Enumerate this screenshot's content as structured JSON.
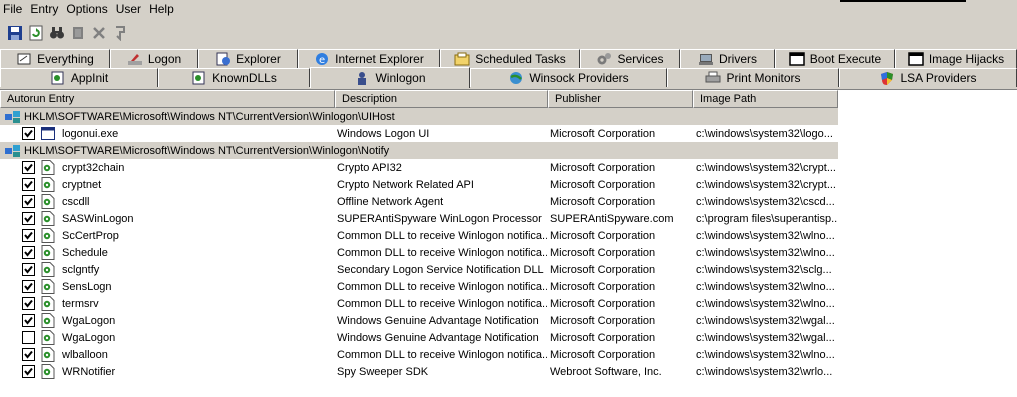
{
  "menu": [
    "File",
    "Entry",
    "Options",
    "User",
    "Help"
  ],
  "toolbar": [
    {
      "name": "save-icon"
    },
    {
      "name": "refresh-icon"
    },
    {
      "name": "find-icon"
    },
    {
      "name": "copy-icon"
    },
    {
      "name": "delete-icon"
    },
    {
      "name": "jump-icon"
    }
  ],
  "tabs_row1": [
    {
      "label": "Everything",
      "icon": "everything-icon"
    },
    {
      "label": "Logon",
      "icon": "logon-icon"
    },
    {
      "label": "Explorer",
      "icon": "explorer-icon"
    },
    {
      "label": "Internet Explorer",
      "icon": "internet-explorer-icon"
    },
    {
      "label": "Scheduled Tasks",
      "icon": "scheduled-tasks-icon"
    },
    {
      "label": "Services",
      "icon": "services-icon"
    },
    {
      "label": "Drivers",
      "icon": "drivers-icon"
    },
    {
      "label": "Boot Execute",
      "icon": "boot-execute-icon"
    },
    {
      "label": "Image Hijacks",
      "icon": "image-hijacks-icon"
    }
  ],
  "tabs_row2": [
    {
      "label": "AppInit",
      "icon": "appinit-icon"
    },
    {
      "label": "KnownDLLs",
      "icon": "knowndlls-icon"
    },
    {
      "label": "Winlogon",
      "icon": "winlogon-icon",
      "selected": true
    },
    {
      "label": "Winsock Providers",
      "icon": "winsock-icon"
    },
    {
      "label": "Print Monitors",
      "icon": "print-monitors-icon"
    },
    {
      "label": "LSA Providers",
      "icon": "lsa-providers-icon"
    }
  ],
  "columns": [
    "Autorun Entry",
    "Description",
    "Publisher",
    "Image Path"
  ],
  "groups": [
    {
      "key": "HKLM\\SOFTWARE\\Microsoft\\Windows NT\\CurrentVersion\\Winlogon\\UIHost",
      "entries": [
        {
          "name": "logonui.exe",
          "checked": true,
          "icon": "window-icon",
          "description": "Windows Logon UI",
          "publisher": "Microsoft Corporation",
          "path": "c:\\windows\\system32\\logo..."
        }
      ]
    },
    {
      "key": "HKLM\\SOFTWARE\\Microsoft\\Windows NT\\CurrentVersion\\Winlogon\\Notify",
      "entries": [
        {
          "name": "crypt32chain",
          "checked": true,
          "icon": "dll-icon",
          "description": "Crypto API32",
          "publisher": "Microsoft Corporation",
          "path": "c:\\windows\\system32\\crypt..."
        },
        {
          "name": "cryptnet",
          "checked": true,
          "icon": "dll-icon",
          "description": "Crypto Network Related API",
          "publisher": "Microsoft Corporation",
          "path": "c:\\windows\\system32\\crypt..."
        },
        {
          "name": "cscdll",
          "checked": true,
          "icon": "dll-icon",
          "description": "Offline Network Agent",
          "publisher": "Microsoft Corporation",
          "path": "c:\\windows\\system32\\cscd..."
        },
        {
          "name": "SASWinLogon",
          "checked": true,
          "icon": "dll-icon",
          "description": "SUPERAntiSpyware WinLogon Processor",
          "publisher": "SUPERAntiSpyware.com",
          "path": "c:\\program files\\superantisp..."
        },
        {
          "name": "ScCertProp",
          "checked": true,
          "icon": "dll-icon",
          "description": "Common DLL to receive Winlogon notifica...",
          "publisher": "Microsoft Corporation",
          "path": "c:\\windows\\system32\\wlno..."
        },
        {
          "name": "Schedule",
          "checked": true,
          "icon": "dll-icon",
          "description": "Common DLL to receive Winlogon notifica...",
          "publisher": "Microsoft Corporation",
          "path": "c:\\windows\\system32\\wlno..."
        },
        {
          "name": "sclgntfy",
          "checked": true,
          "icon": "dll-icon",
          "description": "Secondary Logon Service Notification DLL",
          "publisher": "Microsoft Corporation",
          "path": "c:\\windows\\system32\\sclg..."
        },
        {
          "name": "SensLogn",
          "checked": true,
          "icon": "dll-icon",
          "description": "Common DLL to receive Winlogon notifica...",
          "publisher": "Microsoft Corporation",
          "path": "c:\\windows\\system32\\wlno..."
        },
        {
          "name": "termsrv",
          "checked": true,
          "icon": "dll-icon",
          "description": "Common DLL to receive Winlogon notifica...",
          "publisher": "Microsoft Corporation",
          "path": "c:\\windows\\system32\\wlno..."
        },
        {
          "name": "WgaLogon",
          "checked": true,
          "icon": "dll-icon",
          "description": "Windows Genuine Advantage Notification",
          "publisher": "Microsoft Corporation",
          "path": "c:\\windows\\system32\\wgal..."
        },
        {
          "name": "WgaLogon",
          "checked": false,
          "icon": "dll-icon",
          "description": "Windows Genuine Advantage Notification",
          "publisher": "Microsoft Corporation",
          "path": "c:\\windows\\system32\\wgal..."
        },
        {
          "name": "wlballoon",
          "checked": true,
          "icon": "dll-icon",
          "description": "Common DLL to receive Winlogon notifica...",
          "publisher": "Microsoft Corporation",
          "path": "c:\\windows\\system32\\wlno..."
        },
        {
          "name": "WRNotifier",
          "checked": true,
          "icon": "dll-icon",
          "description": "Spy Sweeper SDK",
          "publisher": "Webroot Software, Inc.",
          "path": "c:\\windows\\system32\\wrlo..."
        }
      ]
    }
  ]
}
